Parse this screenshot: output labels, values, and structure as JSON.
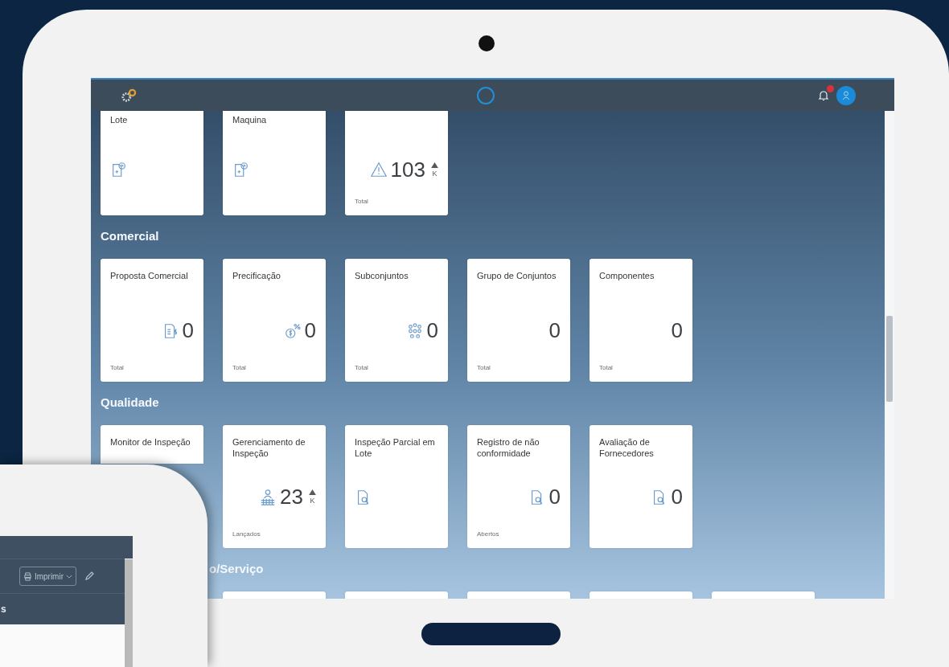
{
  "shell": {
    "notification_badge": true
  },
  "tile_groups": [
    {
      "kind": "scrolled",
      "tiles": [
        {
          "kind": "doc-clock",
          "title": "Lote"
        },
        {
          "kind": "doc-clock",
          "title": "Maquina"
        },
        {
          "kind": "warning",
          "number": "103",
          "trend_up": true,
          "unit": "K",
          "footer": "Total"
        }
      ]
    },
    {
      "kind": "plain",
      "title": "Comercial",
      "tiles": [
        {
          "kind": "doc-dollar",
          "title": "Proposta Comercial",
          "number": "0",
          "footer": "Total"
        },
        {
          "kind": "money-percent",
          "title": "Precificação",
          "number": "0",
          "footer": "Total"
        },
        {
          "kind": "network",
          "title": "Subconjuntos",
          "number": "0",
          "footer": "Total"
        },
        {
          "kind": "plain",
          "title": "Grupo de Conjuntos",
          "number": "0",
          "footer": "Total"
        },
        {
          "kind": "plain",
          "title": "Componentes",
          "number": "0",
          "footer": "Total"
        }
      ]
    },
    {
      "kind": "plain",
      "title": "Qualidade",
      "tiles": [
        {
          "kind": "covered",
          "title": "Monitor de Inspeção"
        },
        {
          "kind": "people",
          "title": "Gerenciamento de Inspeção",
          "number": "23",
          "trend_up": true,
          "unit": "K",
          "footer": "Lançados"
        },
        {
          "kind": "doc-search",
          "title": "Inspeção Parcial em Lote"
        },
        {
          "kind": "doc-search",
          "title": "Registro de não conformidade",
          "number": "0",
          "footer": "Abertos"
        },
        {
          "kind": "doc-search",
          "title": "Avaliação de Fornecedores",
          "number": "0"
        }
      ]
    },
    {
      "kind": "covered",
      "title": "o/Serviço",
      "tiles": [
        {
          "kind": "stub"
        },
        {
          "kind": "stub"
        },
        {
          "kind": "stub"
        },
        {
          "kind": "stub"
        },
        {
          "kind": "stub"
        }
      ]
    }
  ],
  "phone": {
    "print_button": "Imprimir",
    "list_header": "s"
  }
}
